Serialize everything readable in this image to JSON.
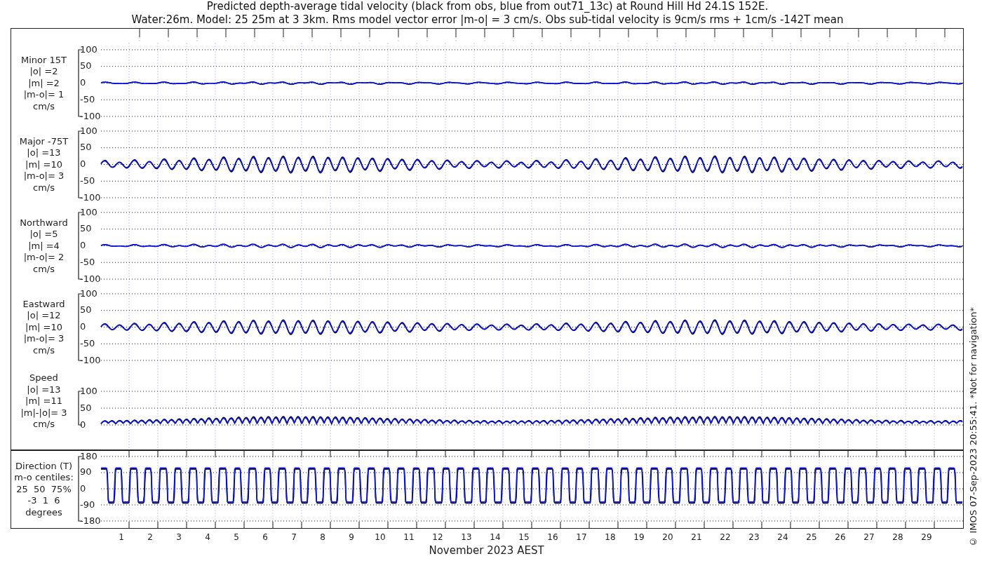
{
  "title_lines": [
    "Predicted depth-average tidal velocity (black from obs, blue from out71_13c) at Round Hill Hd 24.1S 152E.",
    "Water:26m. Model: 25 25m at 3 3km. Rms model vector error |m-o| = 3 cm/s. Obs sub-tidal velocity is 9cm/s rms + 1cm/s -142T mean"
  ],
  "panels": [
    {
      "kind": "signed",
      "label_lines": [
        "Minor 15T",
        "|o| =2",
        "|m| =2",
        "|m-o|= 1",
        "cm/s"
      ],
      "yticks": [
        "100",
        "50",
        "0",
        "-50",
        "-100"
      ]
    },
    {
      "kind": "signed",
      "label_lines": [
        "Major -75T",
        "|o| =13",
        "|m| =10",
        "|m-o|= 3",
        "cm/s"
      ],
      "yticks": [
        "100",
        "50",
        "0",
        "-50",
        "-100"
      ]
    },
    {
      "kind": "signed",
      "label_lines": [
        "Northward",
        "|o| =5",
        "|m| =4",
        "|m-o|= 2",
        "cm/s"
      ],
      "yticks": [
        "100",
        "50",
        "0",
        "-50",
        "-100"
      ]
    },
    {
      "kind": "signed",
      "label_lines": [
        "Eastward",
        "|o| =12",
        "|m| =10",
        "|m-o|= 3",
        "cm/s"
      ],
      "yticks": [
        "100",
        "50",
        "0",
        "-50",
        "-100"
      ]
    },
    {
      "kind": "speed",
      "label_lines": [
        "Speed",
        "|o| =13",
        "|m| =11",
        "|m|-|o|= 3",
        "cm/s"
      ],
      "yticks": [
        "100",
        "50",
        "0"
      ]
    },
    {
      "kind": "direction",
      "label_lines": [
        "Direction (T)",
        "m-o centiles:",
        "25  50  75%",
        "-3  1  6",
        "degrees"
      ],
      "yticks": [
        "180",
        "90",
        "0",
        "-90",
        "-180"
      ]
    }
  ],
  "xticks": [
    "1",
    "2",
    "3",
    "4",
    "5",
    "6",
    "7",
    "8",
    "9",
    "10",
    "11",
    "12",
    "13",
    "14",
    "15",
    "16",
    "17",
    "18",
    "19",
    "20",
    "21",
    "22",
    "23",
    "24",
    "25",
    "26",
    "27",
    "28",
    "29"
  ],
  "xlabel": "November 2023 AEST",
  "side_note": "© IMOS 07-Sep-2023 20:55:41. *Not for navigation*"
}
